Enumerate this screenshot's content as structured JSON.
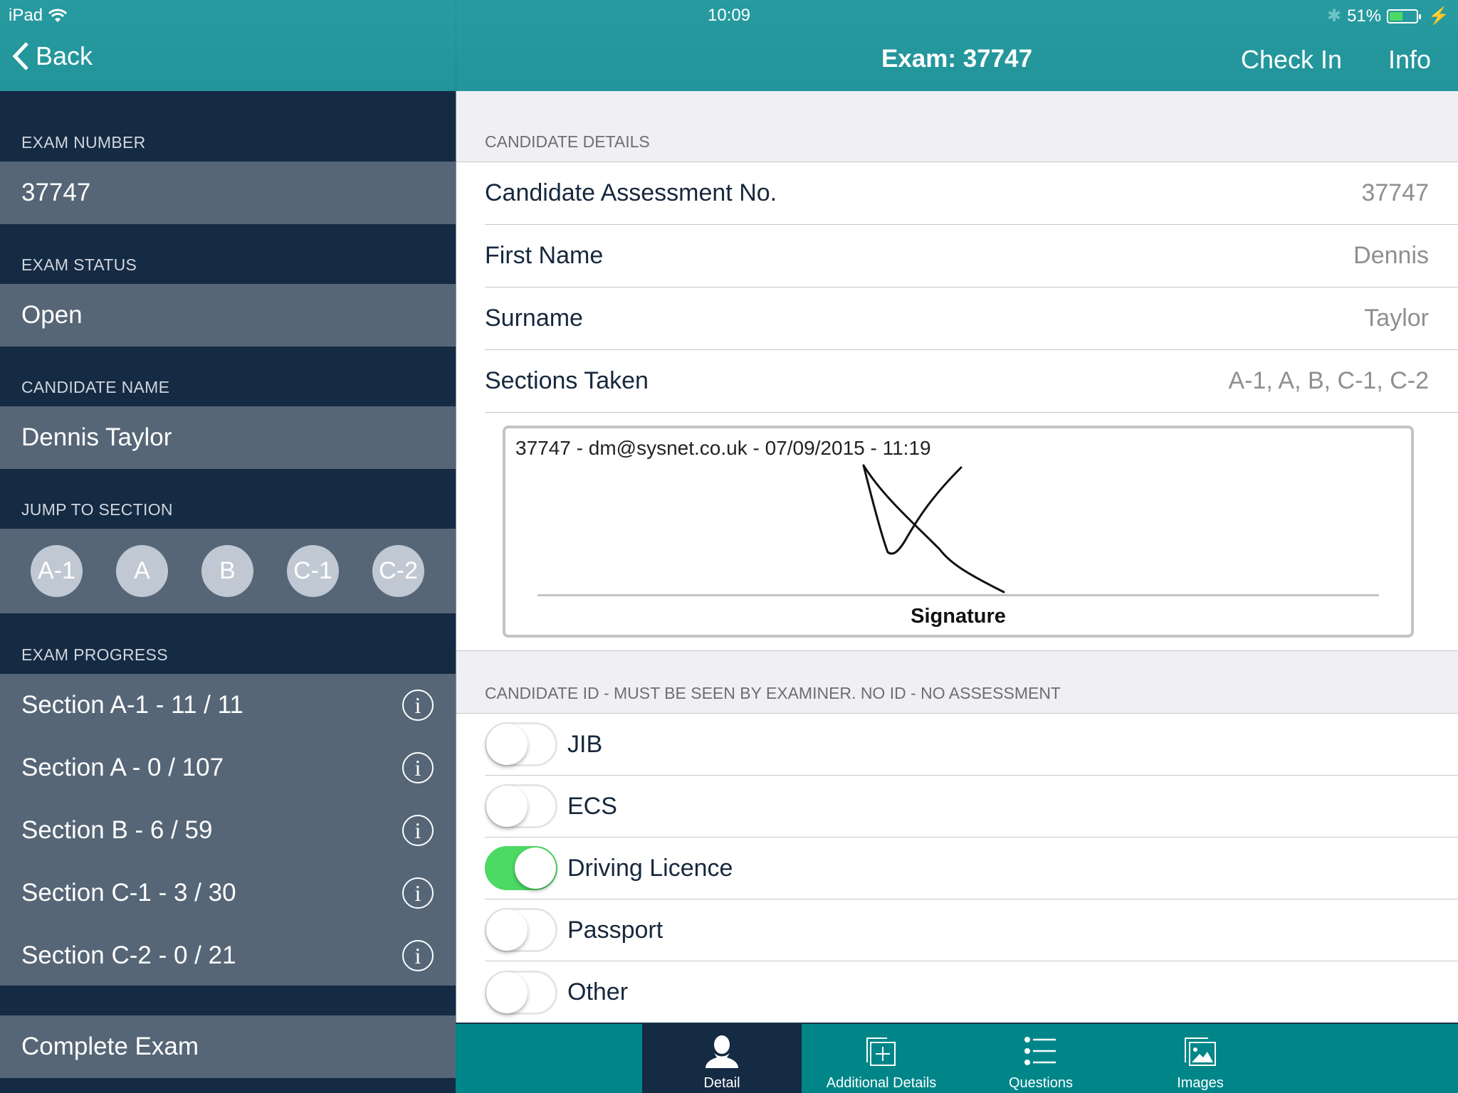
{
  "status_bar": {
    "device": "iPad",
    "time": "10:09",
    "battery_percent": "51%",
    "battery_level": 0.51,
    "icons": [
      "wifi-icon",
      "bluetooth-icon",
      "battery-icon",
      "charging-icon"
    ]
  },
  "nav": {
    "back_label": "Back",
    "title": "Exam: 37747",
    "check_in_label": "Check In",
    "info_label": "Info"
  },
  "sidebar": {
    "exam_number_label": "EXAM NUMBER",
    "exam_number": "37747",
    "exam_status_label": "EXAM STATUS",
    "exam_status": "Open",
    "candidate_name_label": "CANDIDATE NAME",
    "candidate_name": "Dennis Taylor",
    "jump_label": "JUMP TO SECTION",
    "jump_sections": [
      "A-1",
      "A",
      "B",
      "C-1",
      "C-2"
    ],
    "progress_label": "EXAM PROGRESS",
    "progress": [
      {
        "label": "Section A-1 - 11 / 11"
      },
      {
        "label": "Section A - 0 / 107"
      },
      {
        "label": "Section B - 6 / 59"
      },
      {
        "label": "Section C-1 - 3 / 30"
      },
      {
        "label": "Section C-2 - 0 / 21"
      }
    ],
    "complete_label": "Complete Exam"
  },
  "main": {
    "candidate_details_header": "CANDIDATE DETAILS",
    "details": [
      {
        "label": "Candidate Assessment No.",
        "value": "37747"
      },
      {
        "label": "First Name",
        "value": "Dennis"
      },
      {
        "label": "Surname",
        "value": "Taylor"
      },
      {
        "label": "Sections Taken",
        "value": "A-1, A, B, C-1, C-2"
      }
    ],
    "signature": {
      "meta": "37747 - dm@sysnet.co.uk - 07/09/2015 - 11:19",
      "caption": "Signature"
    },
    "id_header": "CANDIDATE ID - MUST BE SEEN BY EXAMINER. NO ID - NO ASSESSMENT",
    "id_options": [
      {
        "label": "JIB",
        "on": false
      },
      {
        "label": "ECS",
        "on": false
      },
      {
        "label": "Driving Licence",
        "on": true
      },
      {
        "label": "Passport",
        "on": false
      },
      {
        "label": "Other",
        "on": false
      }
    ]
  },
  "tabs": [
    {
      "label": "Detail",
      "icon": "person-icon",
      "active": true
    },
    {
      "label": "Additional Details",
      "icon": "add-copy-icon",
      "active": false
    },
    {
      "label": "Questions",
      "icon": "list-icon",
      "active": false
    },
    {
      "label": "Images",
      "icon": "images-icon",
      "active": false
    }
  ],
  "colors": {
    "header": "#22949a",
    "sidebar_bg": "#152a43",
    "sidebar_row": "#566677",
    "toggle_on": "#4cd964",
    "tabbar": "#008689"
  }
}
